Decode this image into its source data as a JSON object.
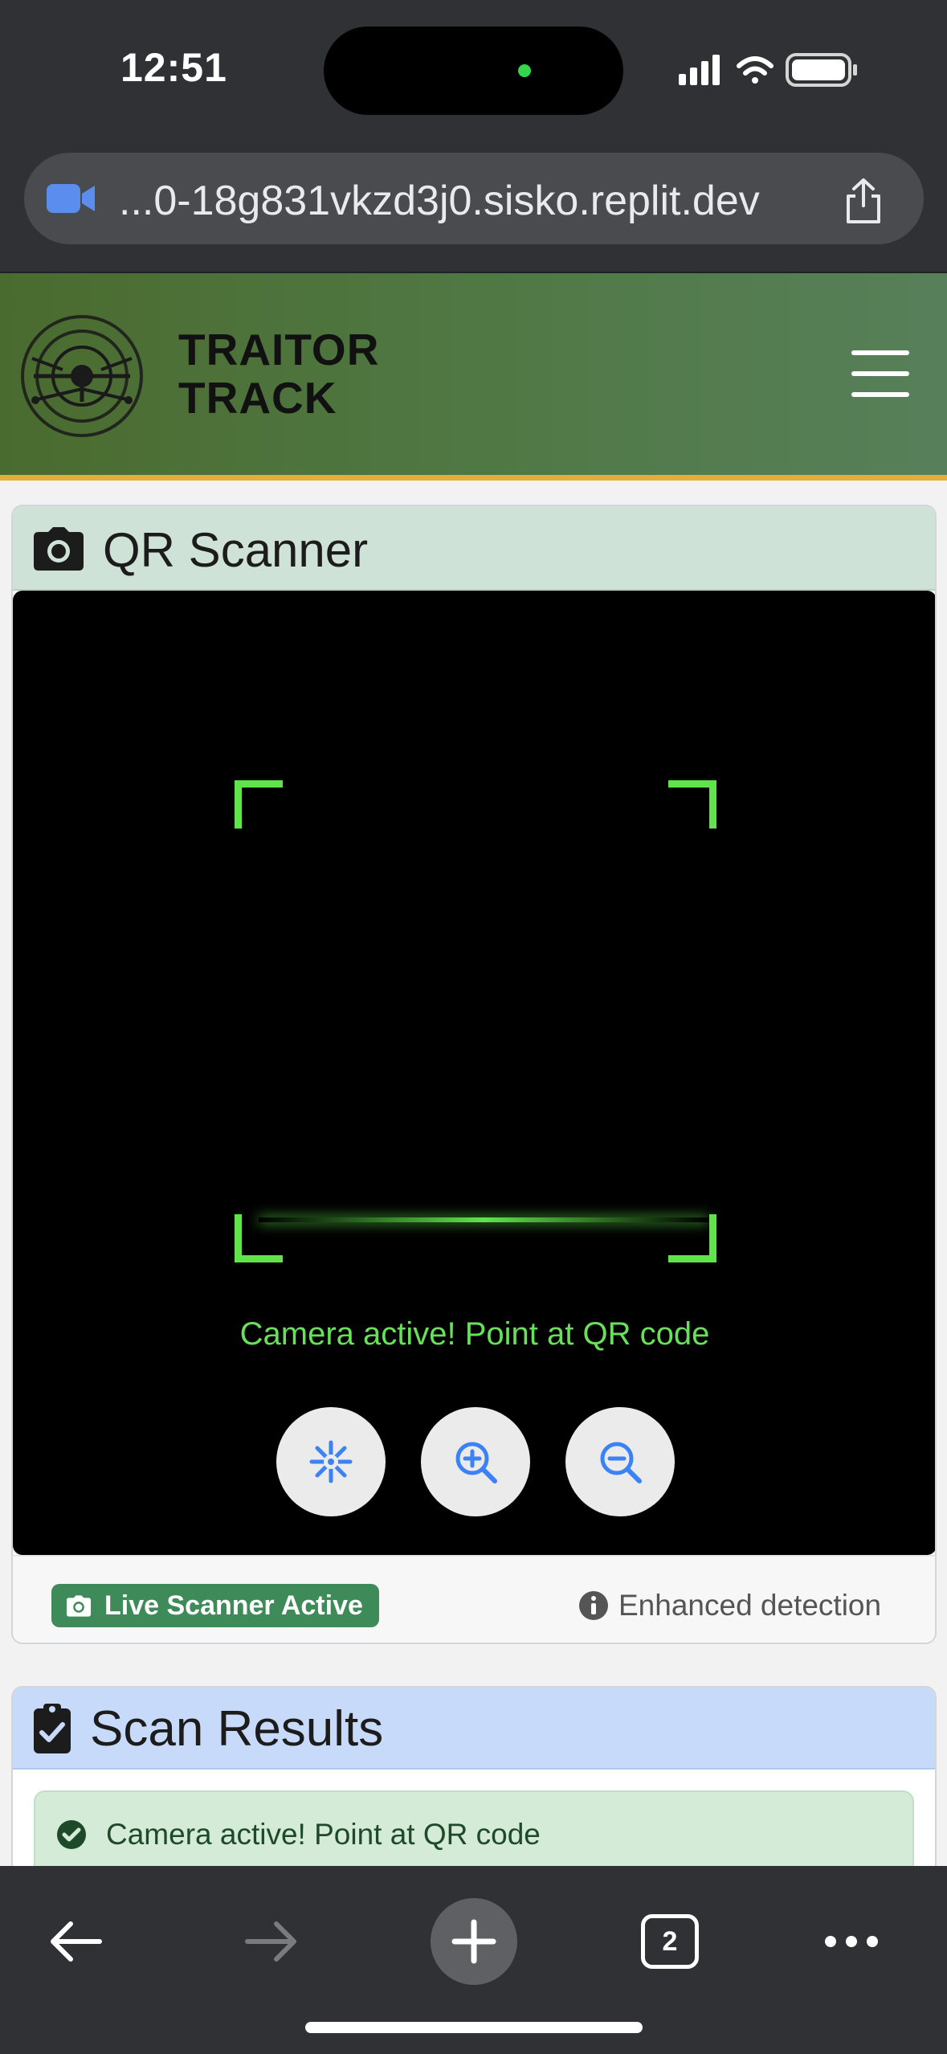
{
  "status_bar": {
    "time": "12:51"
  },
  "browser": {
    "url": "...0-18g831vkzd3j0.sisko.replit.dev",
    "open_tabs": "2"
  },
  "header": {
    "brand_line1": "TRAITOR",
    "brand_line2": "TRACK"
  },
  "scanner": {
    "title": "QR Scanner",
    "camera_status": "Camera active! Point at QR code",
    "controls": [
      "focus-icon",
      "zoom-in-icon",
      "zoom-out-icon"
    ],
    "badge": "Live Scanner Active",
    "info": "Enhanced detection",
    "accent_color": "#5fe44a"
  },
  "results": {
    "title": "Scan Results",
    "message": "Camera active! Point at QR code"
  },
  "colors": {
    "header_gradient_start": "#4a6b2f",
    "header_gradient_end": "#57805a",
    "header_border": "#e5ad3a",
    "badge_bg": "#3e8b59",
    "control_icon": "#3b82f6"
  }
}
